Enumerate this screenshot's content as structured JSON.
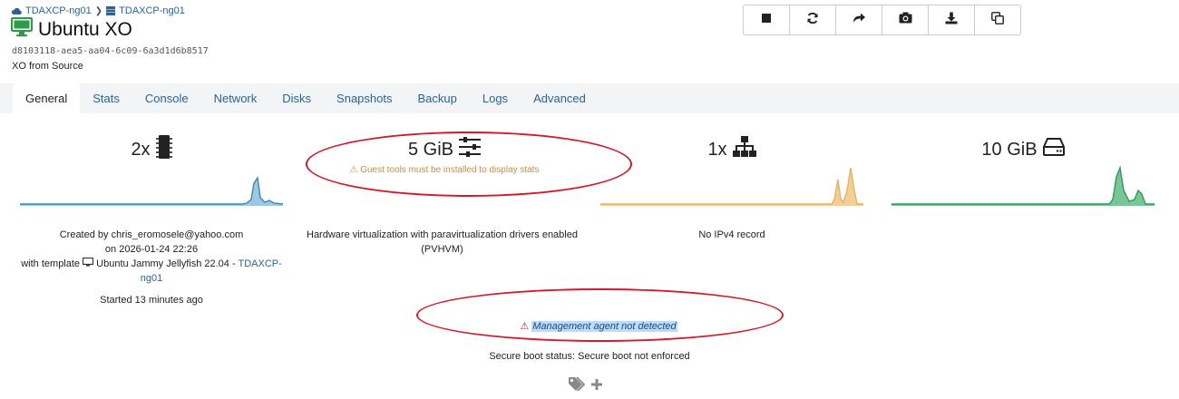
{
  "breadcrumb": {
    "pool": "TDAXCP-ng01",
    "host": "TDAXCP-ng01"
  },
  "vm": {
    "name": "Ubuntu XO",
    "uuid": "d8103118-aea5-aa04-6c09-6a3d1d6b8517",
    "description": "XO from Source"
  },
  "tabs": [
    "General",
    "Stats",
    "Console",
    "Network",
    "Disks",
    "Snapshots",
    "Backup",
    "Logs",
    "Advanced"
  ],
  "stats": {
    "cpu": "2x",
    "memory": "5 GiB",
    "memory_warning": "Guest tools must be installed to display stats",
    "network": "1x",
    "disk": "10 GiB"
  },
  "info": {
    "created_by": "Created by chris_eromosele@yahoo.com",
    "created_on": "on 2026-01-24 22:26",
    "template_prefix": "with template",
    "template_name": "Ubuntu Jammy Jellyfish 22.04",
    "template_sep": " - ",
    "template_host_a": "TDAXCP-",
    "template_host_b": "ng01",
    "started": "Started 13 minutes ago",
    "virtualization_1": "Hardware virtualization with paravirtualization drivers enabled",
    "virtualization_2": "(PVHVM)",
    "ipv4": "No IPv4 record",
    "management_agent": "Management agent not detected",
    "secure_boot": "Secure boot status: Secure boot not enforced"
  },
  "colors": {
    "link": "#2a6496",
    "cpu_chart": "#4a9cc7",
    "network_chart": "#f0c27a",
    "disk_chart": "#3fae6a",
    "annotation": "#d11a2a",
    "warning": "#d18b3c",
    "danger": "#a83232"
  },
  "icons": {
    "toolbar": [
      "stop-icon",
      "restart-icon",
      "migrate-icon",
      "snapshot-icon",
      "export-icon",
      "copy-icon"
    ]
  }
}
